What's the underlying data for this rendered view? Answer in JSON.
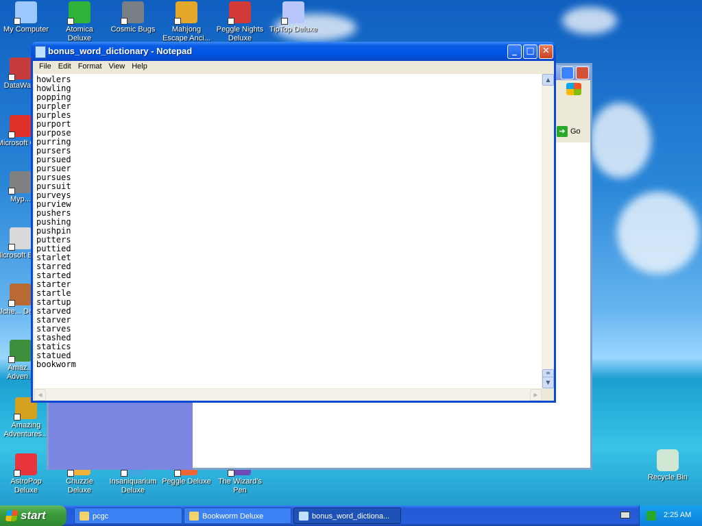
{
  "desktop": {
    "top_icons": [
      {
        "label": "My Computer",
        "color": "#9cc7ff"
      },
      {
        "label": "Atomica Deluxe",
        "color": "#2fb23a"
      },
      {
        "label": "Cosmic Bugs",
        "color": "#7a7f86"
      },
      {
        "label": "Mahjong Escape Anci...",
        "color": "#e3a82a"
      },
      {
        "label": "Peggle Nights Deluxe",
        "color": "#d23a3a"
      },
      {
        "label": "TipTop Deluxe",
        "color": "#b8c8ff"
      }
    ],
    "left_icons": [
      {
        "label": "DataWa...",
        "color": "#c63c3c"
      },
      {
        "label": "Microsoft C++",
        "color": "#e0302a"
      },
      {
        "label": "Myp...",
        "color": "#808080"
      },
      {
        "label": "Microsoft Basic",
        "color": "#d9d9d9"
      },
      {
        "label": "Alche... Delu...",
        "color": "#b96a34"
      },
      {
        "label": "Amaz... Adven...",
        "color": "#3d8f3d"
      },
      {
        "label": "Amazing Adventures...",
        "color": "#d4a020"
      },
      {
        "label": "AstroPop Deluxe",
        "color": "#e7343d"
      }
    ],
    "bottom_icons": [
      {
        "label": "Chuzzle Deluxe",
        "color": "#f0b23a"
      },
      {
        "label": "Insaniquarium Deluxe",
        "color": "#3fa6e0"
      },
      {
        "label": "Peggle Deluxe",
        "color": "#ee6633"
      },
      {
        "label": "The Wizard's Pen",
        "color": "#6c4bb6"
      }
    ],
    "recycle_bin": {
      "label": "Recycle Bin",
      "color": "#cfe7d3"
    }
  },
  "background_window": {
    "go_label": "Go"
  },
  "notepad": {
    "title": "bonus_word_dictionary - Notepad",
    "menu": [
      "File",
      "Edit",
      "Format",
      "View",
      "Help"
    ],
    "buttons": {
      "minimize": "_",
      "maximize": "□",
      "close": "✕"
    },
    "lines": [
      "howlers",
      "howling",
      "popping",
      "purpler",
      "purples",
      "purport",
      "purpose",
      "purring",
      "pursers",
      "pursued",
      "pursuer",
      "pursues",
      "pursuit",
      "purveys",
      "purview",
      "pushers",
      "pushing",
      "pushpin",
      "putters",
      "puttied",
      "starlet",
      "starred",
      "started",
      "starter",
      "startle",
      "startup",
      "starved",
      "starver",
      "starves",
      "stashed",
      "statics",
      "statued",
      "bookworm"
    ]
  },
  "taskbar": {
    "start_label": "start",
    "tasks": [
      {
        "label": "pcgc",
        "active": false
      },
      {
        "label": "Bookworm Deluxe",
        "active": false
      },
      {
        "label": "bonus_word_dictiona...",
        "active": true
      }
    ],
    "clock": "2:25 AM"
  }
}
